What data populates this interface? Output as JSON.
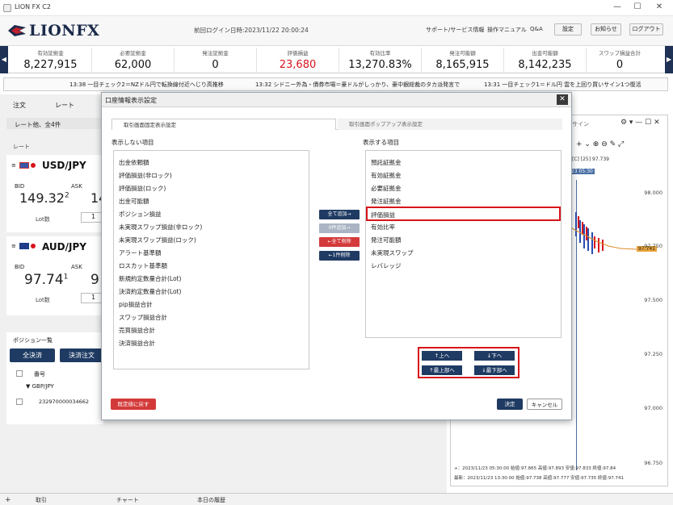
{
  "app": {
    "title": "LION FX C2",
    "logo_text": "LIONFX"
  },
  "header": {
    "last_login": "前回ログイン日時:2023/11/22 20:00:24",
    "links": [
      "サポート/サービス情報",
      "操作マニュアル",
      "Q&A"
    ],
    "buttons": [
      "設定",
      "お知らせ",
      "ログアウト"
    ]
  },
  "summary": [
    {
      "label": "有効証拠金",
      "value": "8,227,915"
    },
    {
      "label": "必要証拠金",
      "value": "62,000"
    },
    {
      "label": "発注証拠金",
      "value": "0"
    },
    {
      "label": "評価損益",
      "value": "23,680",
      "color": "#d8141b"
    },
    {
      "label": "有効比率",
      "value": "13,270.83%"
    },
    {
      "label": "発注可能額",
      "value": "8,165,915"
    },
    {
      "label": "出金可能額",
      "value": "8,142,235"
    },
    {
      "label": "スワップ損益合計",
      "value": "0"
    }
  ],
  "news": [
    "13:38 一目チェック2＝NZドル円で転換線付近へじり高推移",
    "13:32 シドニー外為・債券市場＝豪ドルがしっかり、豪中銀総裁のタカ派発言で",
    "13:31 一目チェック1＝ドル円 雲を上回り買いサイン1つ復活"
  ],
  "left": {
    "menu": [
      "注文",
      "レート"
    ],
    "rate_header": "レート他、全4件",
    "rate_label": "レート",
    "pairs": [
      {
        "name": "USD/JPY",
        "bid_label": "BID",
        "ask_label": "ASK",
        "bid_main": "149.32",
        "bid_sub": "2",
        "ask_main": "14",
        "lot_label": "Lot数",
        "lot_value": "1"
      },
      {
        "name": "AUD/JPY",
        "bid_label": "BID",
        "ask_label": "ASK",
        "bid_main": "97.74",
        "bid_sub": "1",
        "ask_main": "9",
        "lot_label": "Lot数",
        "lot_value": "1"
      }
    ],
    "positions_title": "ポジション一覧",
    "btn_all_settle": "全決済",
    "btn_settle_order": "決済注文",
    "col_number": "番号",
    "group_pair": "GBP/JPY",
    "row_number": "232970000034662"
  },
  "dialog": {
    "title": "口座情報表示設定",
    "tab_fixed": "取引画面固定表示設定",
    "tab_popup": "取引画面ポップアップ表示設定",
    "hidden_header": "表示しない項目",
    "shown_header": "表示する項目",
    "hidden_items": [
      "出金依頼額",
      "評価損益(非ロック)",
      "評価損益(ロック)",
      "出金可能額",
      "ポジション損益",
      "未実現スワップ損益(非ロック)",
      "未実現スワップ損益(ロック)",
      "アラート基準額",
      "ロスカット基準額",
      "新規約定数量合計(Lot)",
      "決済約定数量合計(Lot)",
      "pip損益合計",
      "スワップ損益合計",
      "売買損益合計",
      "決済損益合計"
    ],
    "shown_items": [
      "預託証拠金",
      "有効証拠金",
      "必要証拠金",
      "発注証拠金",
      "評価損益",
      "有効比率",
      "発注可能額",
      "未実現スワップ",
      "レバレッジ"
    ],
    "selected_item": "評価損益",
    "btn_add_all": "全て追加→",
    "btn_add_one": "0件追加→",
    "btn_remove_all": "←全て削除",
    "btn_remove_one": "←1件削除",
    "btn_up": "↑上へ",
    "btn_down": "↓下へ",
    "btn_top": "↑最上部へ",
    "btn_bottom": "↓最下部へ",
    "btn_reset": "既定値に戻す",
    "btn_ok": "決定",
    "btn_cancel": "キャンセル"
  },
  "chart": {
    "info": "[C] [25] 97.739",
    "tag": "23 05:30",
    "price_tag": "97.741",
    "y_ticks": [
      "98.000",
      "97.750",
      "97.500",
      "97.250",
      "97.000",
      "96.750"
    ],
    "foot1": "+：2023/11/23 05:30:00 始値:97.865 高値:97.893 安値:97.833 終値:97.84",
    "foot2": "最新：2023/11/23 13:30:00 始値:97.738 高値:97.777 安値:97.735 終値:97.741",
    "toolbar_label": "サイン"
  },
  "bottom_tabs": [
    "取引",
    "チャート",
    "本日の履歴"
  ]
}
